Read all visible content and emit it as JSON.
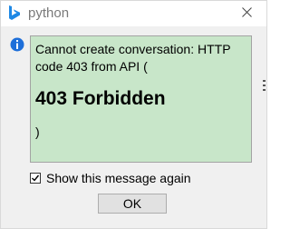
{
  "window": {
    "title": "python",
    "app_icon": "bing-b-icon",
    "close_icon": "close-icon"
  },
  "dialog": {
    "info_icon": "info-icon",
    "message_line1": "Cannot create conversation: HTTP",
    "message_line2": "code 403 from API (",
    "message_heading": "403 Forbidden",
    "message_line3": ")",
    "message_background": "#c8e6c9",
    "checkbox_label": "Show this message again",
    "checkbox_checked": true,
    "ok_label": "OK"
  },
  "colors": {
    "info_icon_blue": "#1e6fd9",
    "app_icon_blue": "#1e88e5"
  }
}
